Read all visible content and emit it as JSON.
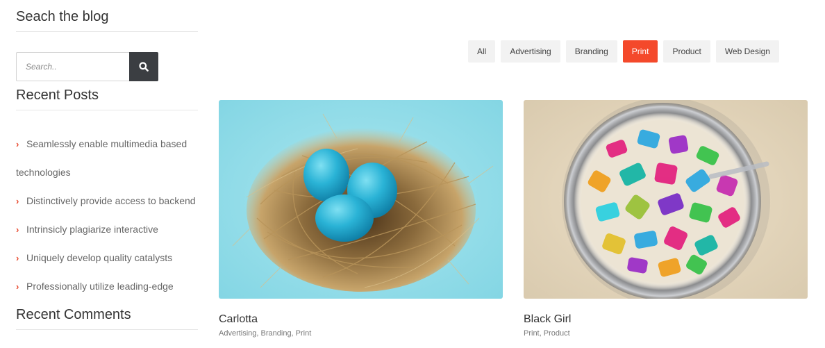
{
  "sidebar": {
    "search_title": "Seach the blog",
    "search_placeholder": "Search..",
    "recent_posts_title": "Recent Posts",
    "recent_posts": [
      {
        "line1": "Seamlessly enable multimedia based",
        "line2": "technologies"
      },
      {
        "line1": "Distinctively provide access to backend"
      },
      {
        "line1": "Intrinsicly plagiarize interactive"
      },
      {
        "line1": "Uniquely develop quality catalysts"
      },
      {
        "line1": "Professionally utilize leading-edge"
      }
    ],
    "recent_comments_title": "Recent Comments"
  },
  "filters": [
    "All",
    "Advertising",
    "Branding",
    "Print",
    "Product",
    "Web Design"
  ],
  "active_filter": "Print",
  "portfolio": [
    {
      "title": "Carlotta",
      "categories": "Advertising, Branding, Print",
      "image": "blue-eggs-in-nest"
    },
    {
      "title": "Black Girl",
      "categories": "Print, Product",
      "image": "jar-of-colorful-letters"
    }
  ],
  "colors": {
    "accent": "#f4492b",
    "search_button": "#3b3e42"
  }
}
